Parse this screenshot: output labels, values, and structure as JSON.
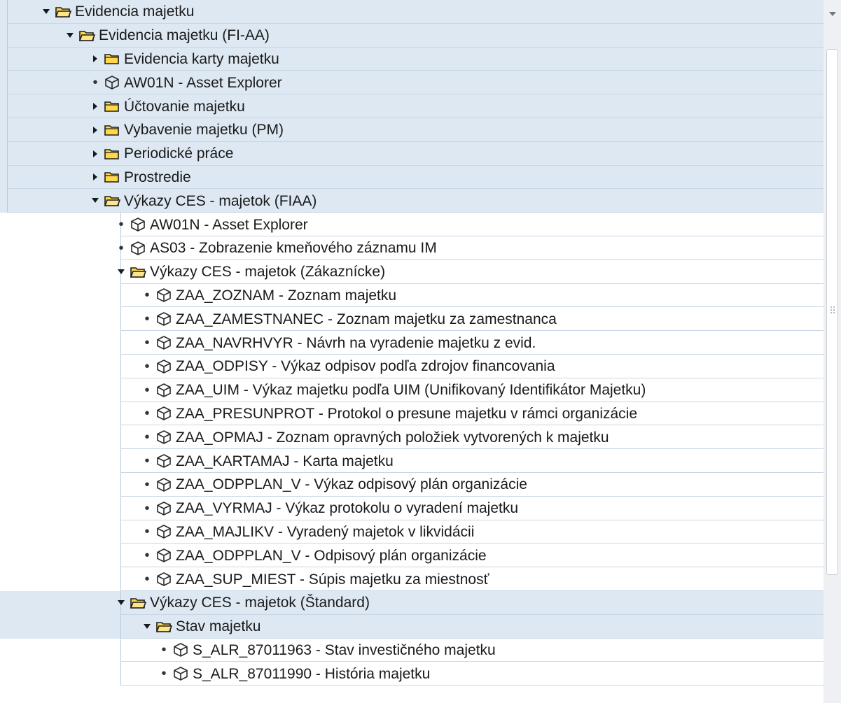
{
  "tree": [
    {
      "level": 0,
      "type": "folder",
      "expanded": true,
      "label": "Evidencia majetku",
      "bg": "blue"
    },
    {
      "level": 1,
      "type": "folder",
      "expanded": true,
      "label": "Evidencia majetku (FI-AA)",
      "bg": "blue"
    },
    {
      "level": 2,
      "type": "folder",
      "expanded": false,
      "label": "Evidencia karty majetku",
      "bg": "blue"
    },
    {
      "level": 2,
      "type": "transaction",
      "label": "AW01N - Asset Explorer",
      "bg": "blue"
    },
    {
      "level": 2,
      "type": "folder",
      "expanded": false,
      "label": "Účtovanie majetku",
      "bg": "blue"
    },
    {
      "level": 2,
      "type": "folder",
      "expanded": false,
      "label": "Vybavenie majetku (PM)",
      "bg": "blue"
    },
    {
      "level": 2,
      "type": "folder",
      "expanded": false,
      "label": "Periodické práce",
      "bg": "blue"
    },
    {
      "level": 2,
      "type": "folder",
      "expanded": false,
      "label": "Prostredie",
      "bg": "blue"
    },
    {
      "level": 2,
      "type": "folder",
      "expanded": true,
      "label": "Výkazy CES - majetok (FIAA)",
      "bg": "blue"
    },
    {
      "level": 3,
      "type": "transaction",
      "label": "AW01N - Asset Explorer",
      "bg": "white"
    },
    {
      "level": 3,
      "type": "transaction",
      "label": "AS03 - Zobrazenie kmeňového záznamu IM",
      "bg": "white"
    },
    {
      "level": 3,
      "type": "folder",
      "expanded": true,
      "label": "Výkazy CES - majetok (Zákaznícke)",
      "bg": "white"
    },
    {
      "level": 4,
      "type": "transaction",
      "label": "ZAA_ZOZNAM - Zoznam majetku",
      "bg": "white"
    },
    {
      "level": 4,
      "type": "transaction",
      "label": "ZAA_ZAMESTNANEC - Zoznam majetku za zamestnanca",
      "bg": "white"
    },
    {
      "level": 4,
      "type": "transaction",
      "label": "ZAA_NAVRHVYR - Návrh na vyradenie majetku z evid.",
      "bg": "white"
    },
    {
      "level": 4,
      "type": "transaction",
      "label": "ZAA_ODPISY - Výkaz odpisov podľa zdrojov financovania",
      "bg": "white"
    },
    {
      "level": 4,
      "type": "transaction",
      "label": "ZAA_UIM - Výkaz majetku podľa UIM (Unifikovaný Identifikátor Majetku)",
      "bg": "white"
    },
    {
      "level": 4,
      "type": "transaction",
      "label": "ZAA_PRESUNPROT - Protokol o presune majetku v rámci organizácie",
      "bg": "white"
    },
    {
      "level": 4,
      "type": "transaction",
      "label": "ZAA_OPMAJ - Zoznam opravných položiek vytvorených k majetku",
      "bg": "white"
    },
    {
      "level": 4,
      "type": "transaction",
      "label": "ZAA_KARTAMAJ - Karta majetku",
      "bg": "white"
    },
    {
      "level": 4,
      "type": "transaction",
      "label": "ZAA_ODPPLAN_V - Výkaz odpisový plán organizácie",
      "bg": "white"
    },
    {
      "level": 4,
      "type": "transaction",
      "label": "ZAA_VYRMAJ - Výkaz protokolu o vyradení majetku",
      "bg": "white"
    },
    {
      "level": 4,
      "type": "transaction",
      "label": "ZAA_MAJLIKV - Vyradený majetok v likvidácii",
      "bg": "white"
    },
    {
      "level": 4,
      "type": "transaction",
      "label": "ZAA_ODPPLAN_V - Odpisový plán organizácie",
      "bg": "white"
    },
    {
      "level": 4,
      "type": "transaction",
      "label": "ZAA_SUP_MIEST - Súpis majetku za miestnosť",
      "bg": "white"
    },
    {
      "level": 3,
      "type": "folder",
      "expanded": true,
      "label": "Výkazy CES - majetok (Štandard)",
      "bg": "blue"
    },
    {
      "level": 4,
      "type": "folder",
      "expanded": true,
      "label": "Stav majetku",
      "bg": "blue"
    },
    {
      "level": 5,
      "type": "transaction",
      "label": "S_ALR_87011963 - Stav investičného majetku",
      "bg": "white"
    },
    {
      "level": 5,
      "type": "transaction",
      "label": "S_ALR_87011990 - História majetku",
      "bg": "white"
    }
  ],
  "icons": {
    "folder_open": "folder-open-icon",
    "folder_closed": "folder-icon",
    "transaction": "transaction-cube-icon",
    "expanded": "triangle-down-icon",
    "collapsed": "triangle-right-icon",
    "scroll_up": "chevron-down-icon"
  },
  "colors": {
    "row_blue": "#dde8f3",
    "row_white": "#ffffff",
    "folder_fill": "#ffd84a",
    "folder_stroke": "#1d1d1d",
    "text": "#1a1a1a"
  }
}
